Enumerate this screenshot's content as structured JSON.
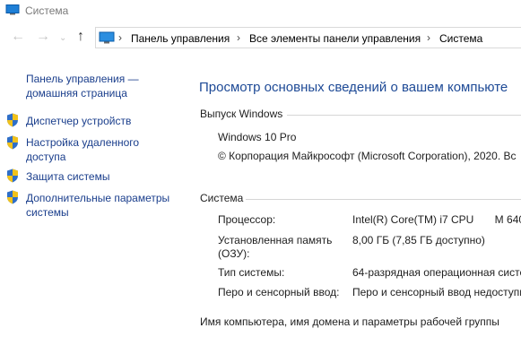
{
  "window": {
    "title": "Система"
  },
  "address": {
    "crumbs": [
      "Панель управления",
      "Все элементы панели управления",
      "Система"
    ]
  },
  "sidebar": {
    "home_label_line1": "Панель управления —",
    "home_label_line2": "домашняя страница",
    "items": [
      {
        "line1": "Диспетчер устройств",
        "line2": ""
      },
      {
        "line1": "Настройка удаленного",
        "line2": "доступа"
      },
      {
        "line1": "Защита системы",
        "line2": ""
      },
      {
        "line1": "Дополнительные параметры",
        "line2": "системы"
      }
    ]
  },
  "main": {
    "title": "Просмотр основных сведений о вашем компьюте",
    "edition": {
      "header": "Выпуск Windows",
      "name": "Windows 10 Pro",
      "copyright": "© Корпорация Майкрософт (Microsoft Corporation), 2020. Вс"
    },
    "system": {
      "header": "Система",
      "rows": [
        {
          "label": "Процессор:",
          "label2": "",
          "value": "Intel(R) Core(TM) i7 CPU       M 640"
        },
        {
          "label": "Установленная память",
          "label2": "(ОЗУ):",
          "value": "8,00 ГБ (7,85 ГБ доступно)"
        },
        {
          "label": "Тип системы:",
          "label2": "",
          "value": "64-разрядная операционная систе"
        },
        {
          "label": "Перо и сенсорный ввод:",
          "label2": "",
          "value": "Перо и сенсорный ввод недоступн"
        }
      ]
    },
    "computer_name_header": "Имя компьютера, имя домена и параметры рабочей группы"
  },
  "colors": {
    "link": "#1a3e8c",
    "heading": "#1e4a96"
  }
}
